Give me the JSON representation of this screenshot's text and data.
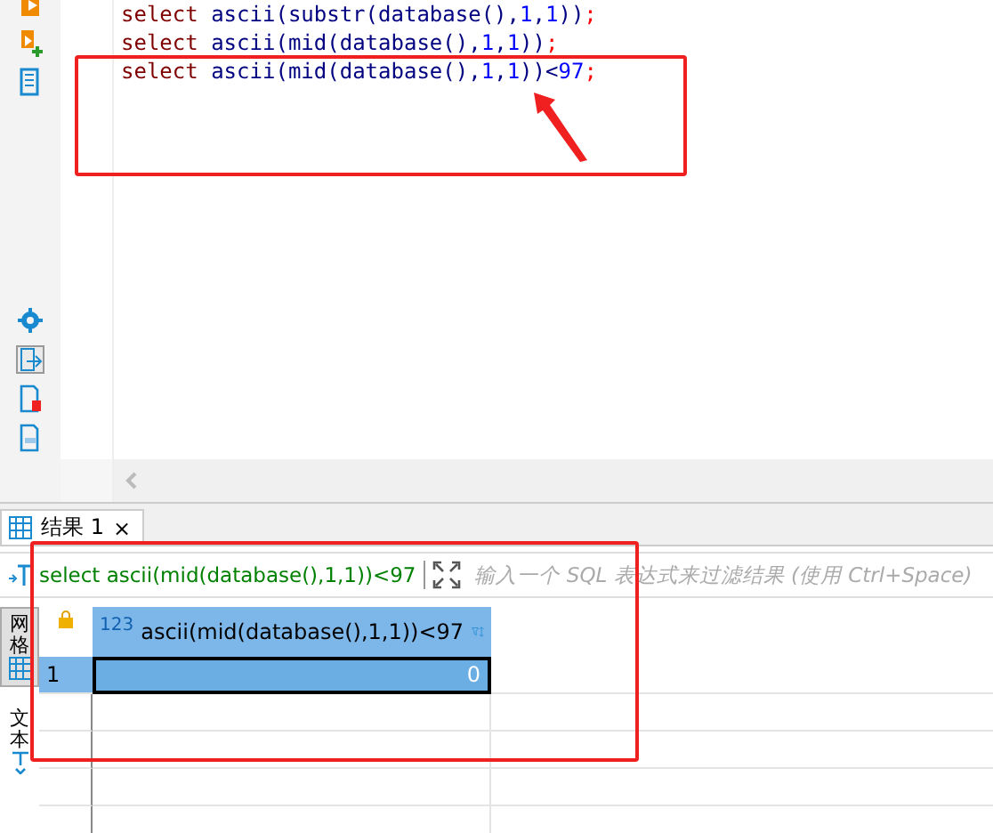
{
  "editor": {
    "lines": [
      {
        "tokens": [
          {
            "kind": "keyword",
            "text": "select"
          },
          {
            "kind": "function",
            "text": "ascii"
          },
          {
            "kind": "punct",
            "text": "("
          },
          {
            "kind": "function",
            "text": "substr"
          },
          {
            "kind": "punct",
            "text": "("
          },
          {
            "kind": "function",
            "text": "database"
          },
          {
            "kind": "punct",
            "text": "(),"
          },
          {
            "kind": "number",
            "text": "1"
          },
          {
            "kind": "punct",
            "text": ","
          },
          {
            "kind": "number",
            "text": "1"
          },
          {
            "kind": "punct",
            "text": "))"
          },
          {
            "kind": "end",
            "text": ";"
          }
        ]
      },
      {
        "tokens": [
          {
            "kind": "keyword",
            "text": "select"
          },
          {
            "kind": "function",
            "text": "ascii"
          },
          {
            "kind": "punct",
            "text": "("
          },
          {
            "kind": "function",
            "text": "mid"
          },
          {
            "kind": "punct",
            "text": "("
          },
          {
            "kind": "function",
            "text": "database"
          },
          {
            "kind": "punct",
            "text": "(),"
          },
          {
            "kind": "number",
            "text": "1"
          },
          {
            "kind": "punct",
            "text": ","
          },
          {
            "kind": "number",
            "text": "1"
          },
          {
            "kind": "punct",
            "text": "))"
          },
          {
            "kind": "end",
            "text": ";"
          }
        ]
      },
      {
        "tokens": [
          {
            "kind": "keyword",
            "text": "select"
          },
          {
            "kind": "function",
            "text": "ascii"
          },
          {
            "kind": "punct",
            "text": "("
          },
          {
            "kind": "function",
            "text": "mid"
          },
          {
            "kind": "punct",
            "text": "("
          },
          {
            "kind": "function",
            "text": "database"
          },
          {
            "kind": "punct",
            "text": "(),"
          },
          {
            "kind": "number",
            "text": "1"
          },
          {
            "kind": "punct",
            "text": ","
          },
          {
            "kind": "number",
            "text": "1"
          },
          {
            "kind": "punct",
            "text": "))"
          },
          {
            "kind": "operator",
            "text": "<"
          },
          {
            "kind": "number",
            "text": "97"
          },
          {
            "kind": "end",
            "text": ";"
          }
        ]
      }
    ]
  },
  "result_tab": {
    "label": "结果 1",
    "close": "×",
    "selected": true
  },
  "filter": {
    "query": "select ascii(mid(database(),1,1))<97",
    "placeholder": "输入一个 SQL 表达式来过滤结果 (使用 Ctrl+Space)"
  },
  "side_tabs": [
    {
      "label": "网格",
      "selected": true
    },
    {
      "label": "文本",
      "selected": false
    }
  ],
  "grid": {
    "columns": [
      {
        "type_label": "123",
        "name": "ascii(mid(database(),1,1))<97"
      }
    ],
    "rows": [
      {
        "number": "1",
        "selected": true,
        "cells": [
          "0"
        ]
      }
    ]
  }
}
